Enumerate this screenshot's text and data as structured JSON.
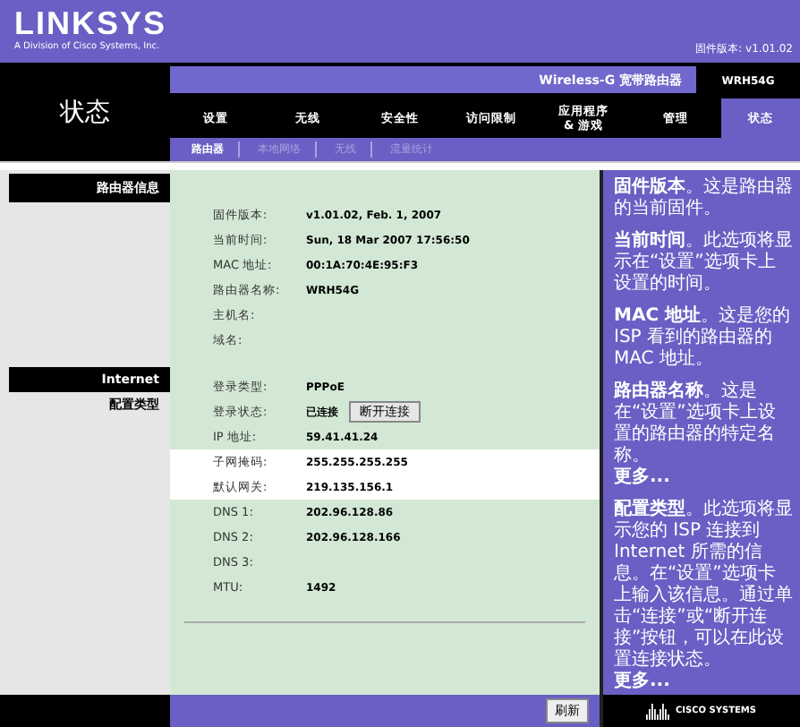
{
  "header": {
    "logo": "LINKSYS",
    "tagline": "A Division of Cisco Systems, Inc.",
    "firmware": "固件版本: v1.01.02"
  },
  "page_title": "状态",
  "product": {
    "name": "Wireless-G 宽带路由器",
    "model": "WRH54G"
  },
  "tabs": [
    {
      "label": "设置",
      "selected": false
    },
    {
      "label": "无线",
      "selected": false
    },
    {
      "label": "安全性",
      "selected": false
    },
    {
      "label": "访问限制",
      "selected": false
    },
    {
      "label": "应用程序\n& 游戏",
      "selected": false
    },
    {
      "label": "管理",
      "selected": false
    },
    {
      "label": "状态",
      "selected": true
    }
  ],
  "subtabs": [
    {
      "label": "路由器",
      "selected": true
    },
    {
      "label": "本地网络",
      "selected": false
    },
    {
      "label": "无线",
      "selected": false
    },
    {
      "label": "流量统计",
      "selected": false
    }
  ],
  "sections": [
    {
      "header": "路由器信息",
      "rows": [
        {
          "label": "固件版本:",
          "value": "v1.01.02, Feb. 1, 2007",
          "highlighted": false
        },
        {
          "label": "当前时间:",
          "value": "Sun, 18 Mar 2007 17:56:50",
          "highlighted": false
        },
        {
          "label": "MAC 地址:",
          "value": "00:1A:70:4E:95:F3",
          "highlighted": false
        },
        {
          "label": "路由器名称:",
          "value": "WRH54G",
          "highlighted": false
        },
        {
          "label": "主机名:",
          "highlighted": false
        },
        {
          "label": "域名:",
          "highlighted": false
        }
      ]
    },
    {
      "header": "Internet",
      "subheader": "配置类型",
      "rows": [
        {
          "label": "登录类型:",
          "value": "PPPoE",
          "highlighted": false
        },
        {
          "label": "登录状态:",
          "value": "已连接",
          "button": "断开连接",
          "highlighted": false
        },
        {
          "label": "IP 地址:",
          "value": "59.41.41.24",
          "highlighted": false
        },
        {
          "label": "子网掩码:",
          "value": "255.255.255.255",
          "highlighted": true
        },
        {
          "label": "默认网关:",
          "value": "219.135.156.1",
          "highlighted": true
        },
        {
          "label": "DNS 1:",
          "value": "202.96.128.86",
          "highlighted": false
        },
        {
          "label": "DNS 2:",
          "value": "202.96.128.166",
          "highlighted": false
        },
        {
          "label": "DNS 3:",
          "highlighted": false
        },
        {
          "label": "MTU:",
          "value": "1492",
          "highlighted": false
        }
      ]
    }
  ],
  "help": [
    {
      "text": "**固件版本**。这是路由器的当前固件。"
    },
    {
      "text": "**当前时间**。此选项将显示在“设置”选项卡上设置的时间。"
    },
    {
      "text": "**MAC 地址**。这是您的 ISP 看到的路由器的 MAC 地址。"
    },
    {
      "text": "**路由器名称**。这是在“设置”选项卡上设置的路由器的特定名称。",
      "more": "更多..."
    },
    {
      "text": "**配置类型**。此选项将显示您的 ISP 连接到 Internet 所需的信息。在“设置”选项卡上输入该信息。通过单击“连接”或“断开连接”按钮，可以在此设置连接状态。",
      "more": "更多..."
    }
  ],
  "refresh_button": "刷新",
  "footer_logo": "CISCO SYSTEMS"
}
